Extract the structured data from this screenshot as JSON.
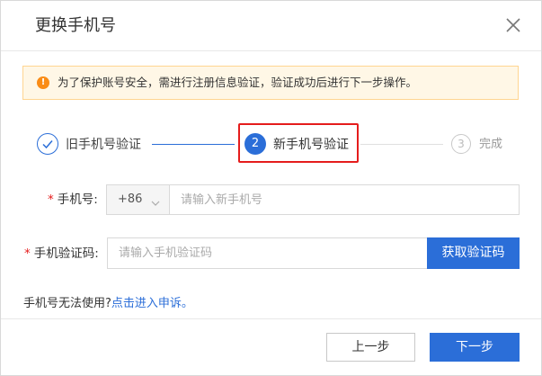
{
  "dialog": {
    "title": "更换手机号",
    "close_icon": "close-icon"
  },
  "notice": {
    "icon": "warning-icon",
    "icon_glyph": "!",
    "text": "为了保护账号安全，需进行注册信息验证，验证成功后进行下一步操作。",
    "bg_color": "#fff7e6",
    "icon_color": "#fa8c16"
  },
  "steps": [
    {
      "label": "旧手机号验证",
      "state": "done",
      "icon": "check-icon"
    },
    {
      "label": "新手机号验证",
      "state": "active",
      "number": "2"
    },
    {
      "label": "完成",
      "state": "pending",
      "number": "3"
    }
  ],
  "form": {
    "required_mark": "*",
    "phone_label": "手机号:",
    "country_code": "+86",
    "phone_placeholder": "请输入新手机号",
    "code_label": "手机验证码:",
    "code_placeholder": "请输入手机验证码",
    "get_code_button": "获取验证码"
  },
  "help": {
    "text": "手机号无法使用?",
    "link": "点击进入申诉。"
  },
  "footer": {
    "prev_button": "上一步",
    "next_button": "下一步"
  },
  "colors": {
    "accent": "#2b6ed8",
    "highlight": "#e51c1c"
  }
}
